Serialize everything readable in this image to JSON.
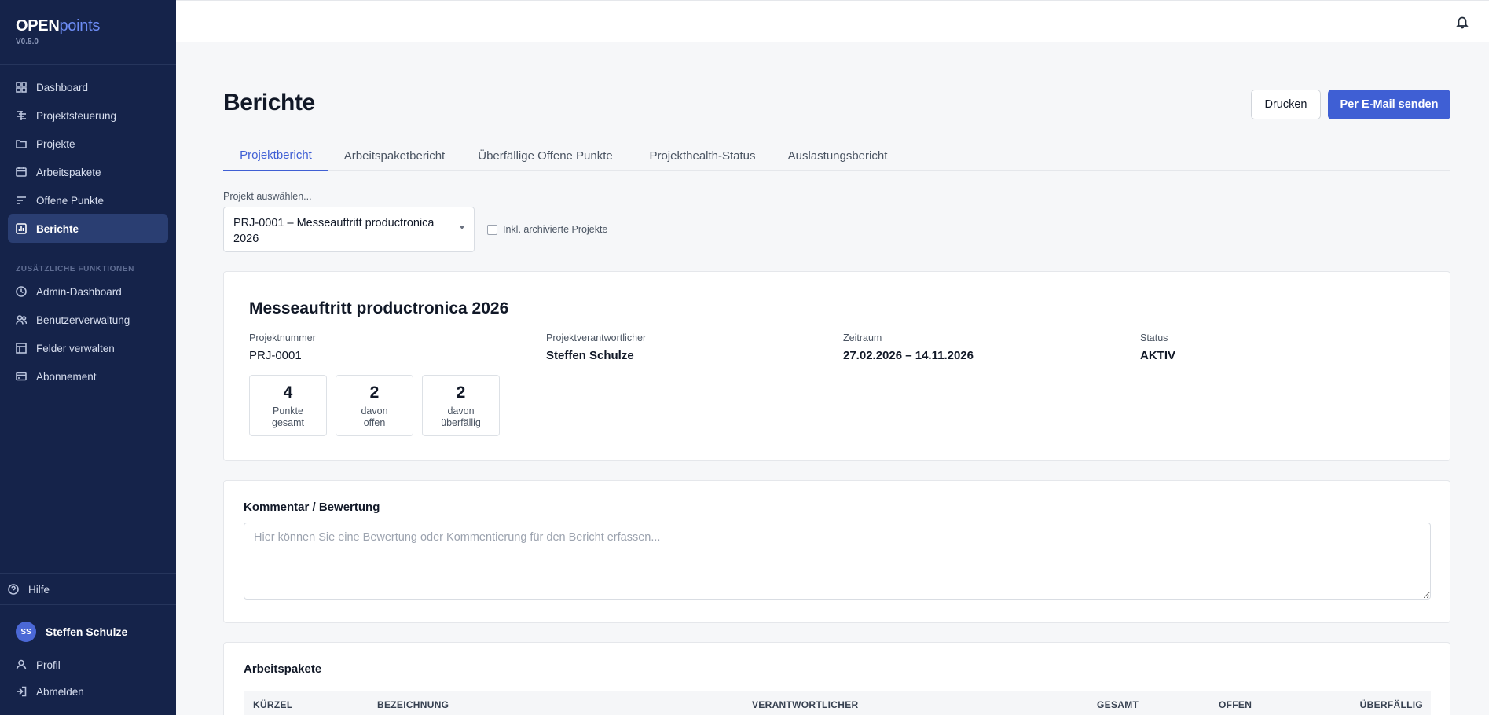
{
  "app": {
    "brand_main": "OPEN",
    "brand_accent": "points",
    "version": "V0.5.0"
  },
  "sidebar": {
    "main_items": [
      {
        "label": "Dashboard",
        "icon": "grid-icon"
      },
      {
        "label": "Projektsteuerung",
        "icon": "gantt-icon"
      },
      {
        "label": "Projekte",
        "icon": "folder-icon"
      },
      {
        "label": "Arbeitspakete",
        "icon": "package-icon"
      },
      {
        "label": "Offene Punkte",
        "icon": "list-icon"
      },
      {
        "label": "Berichte",
        "icon": "chart-icon",
        "active": true
      }
    ],
    "section_label": "ZUSÄTZLICHE FUNKTIONEN",
    "extra_items": [
      {
        "label": "Admin-Dashboard",
        "icon": "clock-icon"
      },
      {
        "label": "Benutzerverwaltung",
        "icon": "users-icon"
      },
      {
        "label": "Felder verwalten",
        "icon": "table-icon"
      },
      {
        "label": "Abonnement",
        "icon": "card-icon"
      }
    ],
    "help_label": "Hilfe",
    "user": {
      "initials": "SS",
      "name": "Steffen Schulze"
    },
    "profile_label": "Profil",
    "logout_label": "Abmelden"
  },
  "header": {
    "title": "Berichte",
    "print_label": "Drucken",
    "email_label": "Per E-Mail senden"
  },
  "tabs": [
    {
      "label": "Projektbericht",
      "active": true
    },
    {
      "label": "Arbeitspaketbericht"
    },
    {
      "label": "Überfällige Offene Punkte"
    },
    {
      "label": "Projekthealth-Status"
    },
    {
      "label": "Auslastungsbericht"
    }
  ],
  "project_select": {
    "label": "Projekt auswählen...",
    "value": "PRJ-0001 – Messeauftritt productronica 2026",
    "archived_label": "Inkl. archivierte Projekte"
  },
  "project": {
    "title": "Messeauftritt productronica 2026",
    "number_label": "Projektnummer",
    "number": "PRJ-0001",
    "owner_label": "Projektverantwortlicher",
    "owner": "Steffen Schulze",
    "period_label": "Zeitraum",
    "period": "27.02.2026 – 14.11.2026",
    "status_label": "Status",
    "status": "AKTIV",
    "stats": [
      {
        "value": "4",
        "label_line1": "Punkte",
        "label_line2": "gesamt"
      },
      {
        "value": "2",
        "label_line1": "davon",
        "label_line2": "offen"
      },
      {
        "value": "2",
        "label_line1": "davon",
        "label_line2": "überfällig"
      }
    ]
  },
  "comment": {
    "title": "Kommentar / Bewertung",
    "placeholder": "Hier können Sie eine Bewertung oder Kommentierung für den Bericht erfassen..."
  },
  "workpackages": {
    "title": "Arbeitspakete",
    "columns": [
      "KÜRZEL",
      "BEZEICHNUNG",
      "VERANTWORTLICHER",
      "GESAMT",
      "OFFEN",
      "ÜBERFÄLLIG"
    ]
  }
}
